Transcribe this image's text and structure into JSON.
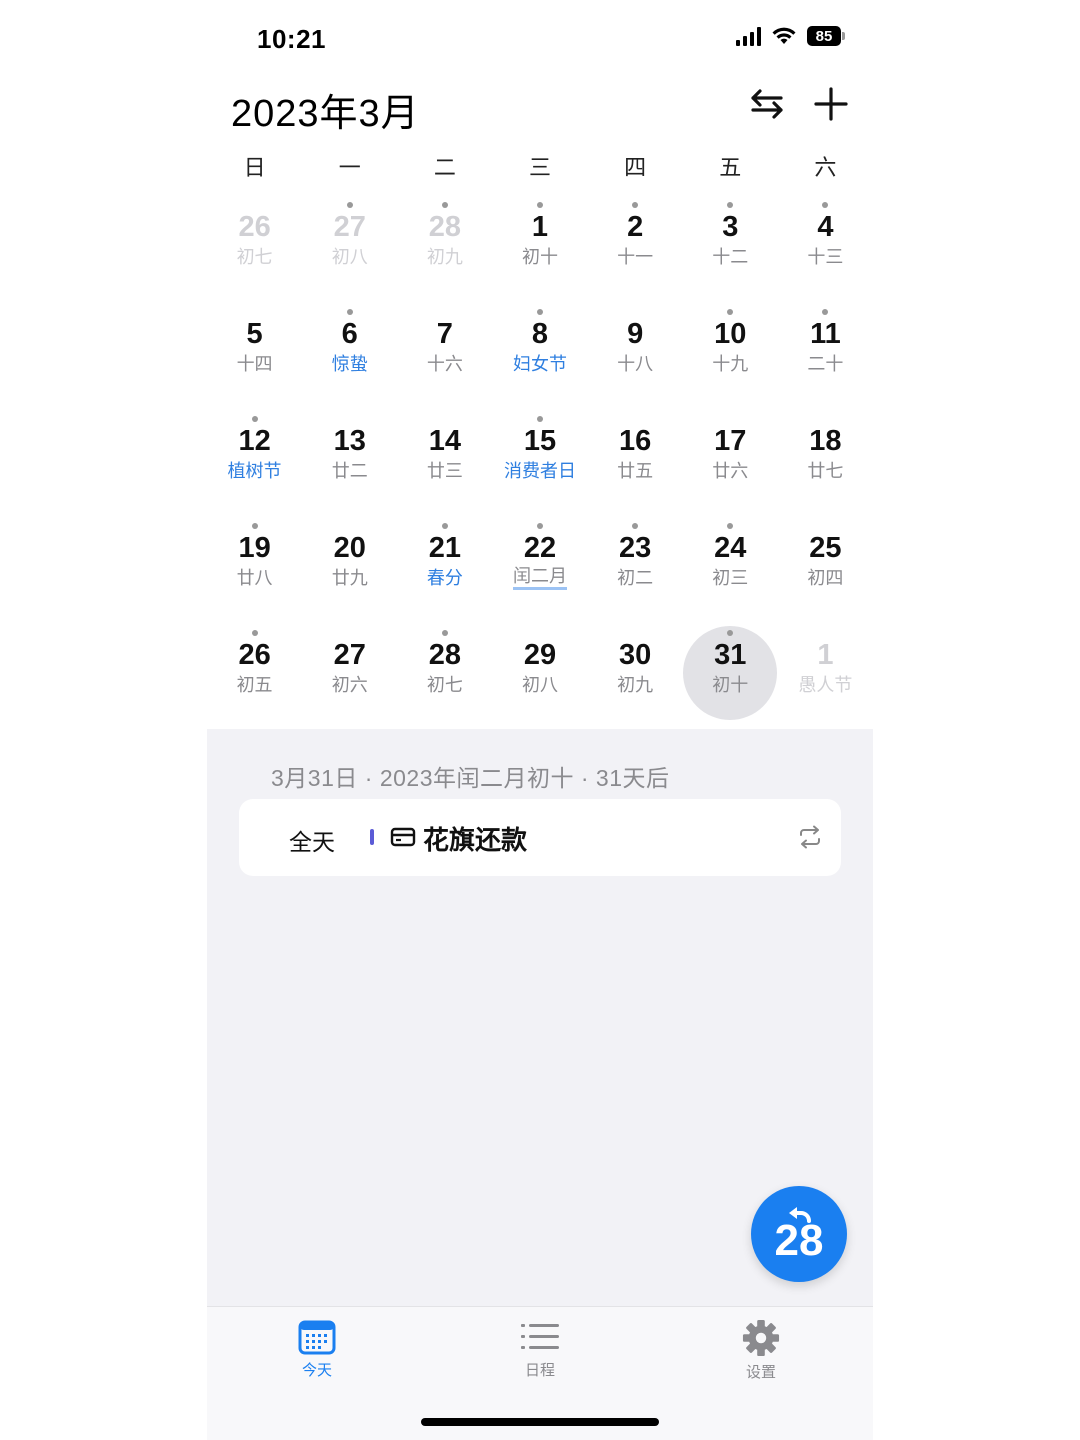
{
  "status": {
    "time": "10:21",
    "battery": "85"
  },
  "header": {
    "title": "2023年3月"
  },
  "weekdays": [
    "日",
    "一",
    "二",
    "三",
    "四",
    "五",
    "六"
  ],
  "days": [
    {
      "n": "26",
      "s": "初七",
      "other": true,
      "dot": false
    },
    {
      "n": "27",
      "s": "初八",
      "other": true,
      "dot": true
    },
    {
      "n": "28",
      "s": "初九",
      "other": true,
      "dot": true
    },
    {
      "n": "1",
      "s": "初十",
      "dot": true
    },
    {
      "n": "2",
      "s": "十一",
      "dot": true
    },
    {
      "n": "3",
      "s": "十二",
      "dot": true
    },
    {
      "n": "4",
      "s": "十三",
      "dot": true
    },
    {
      "n": "5",
      "s": "十四",
      "dot": false
    },
    {
      "n": "6",
      "s": "惊蛰",
      "holiday": true,
      "dot": true
    },
    {
      "n": "7",
      "s": "十六",
      "dot": false
    },
    {
      "n": "8",
      "s": "妇女节",
      "holiday": true,
      "dot": true
    },
    {
      "n": "9",
      "s": "十八",
      "dot": false
    },
    {
      "n": "10",
      "s": "十九",
      "dot": true
    },
    {
      "n": "11",
      "s": "二十",
      "dot": true
    },
    {
      "n": "12",
      "s": "植树节",
      "holiday": true,
      "dot": true
    },
    {
      "n": "13",
      "s": "廿二",
      "dot": false
    },
    {
      "n": "14",
      "s": "廿三",
      "dot": false
    },
    {
      "n": "15",
      "s": "消费者日",
      "holiday": true,
      "dot": true
    },
    {
      "n": "16",
      "s": "廿五",
      "dot": false
    },
    {
      "n": "17",
      "s": "廿六",
      "dot": false
    },
    {
      "n": "18",
      "s": "廿七",
      "dot": false
    },
    {
      "n": "19",
      "s": "廿八",
      "dot": true
    },
    {
      "n": "20",
      "s": "廿九",
      "dot": false
    },
    {
      "n": "21",
      "s": "春分",
      "holiday": true,
      "dot": true
    },
    {
      "n": "22",
      "s": "闰二月",
      "special": true,
      "dot": true
    },
    {
      "n": "23",
      "s": "初二",
      "dot": true
    },
    {
      "n": "24",
      "s": "初三",
      "dot": true
    },
    {
      "n": "25",
      "s": "初四",
      "dot": false
    },
    {
      "n": "26",
      "s": "初五",
      "dot": true
    },
    {
      "n": "27",
      "s": "初六",
      "dot": false
    },
    {
      "n": "28",
      "s": "初七",
      "dot": true
    },
    {
      "n": "29",
      "s": "初八",
      "dot": false
    },
    {
      "n": "30",
      "s": "初九",
      "dot": false
    },
    {
      "n": "31",
      "s": "初十",
      "selected": true,
      "dot": true
    },
    {
      "n": "1",
      "s": "愚人节",
      "other": true,
      "dot": false
    }
  ],
  "agenda": {
    "date_line": "3月31日 · 2023年闰二月初十 · 31天后",
    "event": {
      "allday": "全天",
      "title": "花旗还款",
      "icon": "card-icon",
      "repeat_icon": "repeat-icon",
      "bar_color": "#5b5bd6"
    }
  },
  "fab": {
    "label": "28",
    "icon": "back-arrow-icon"
  },
  "tabs": [
    {
      "label": "今天",
      "icon": "calendar-icon",
      "active": true
    },
    {
      "label": "日程",
      "icon": "list-icon",
      "active": false
    },
    {
      "label": "设置",
      "icon": "gear-icon",
      "active": false
    }
  ],
  "colors": {
    "accent": "#1a7ff0",
    "holiday": "#2f7fe0",
    "agenda_bg": "#f2f2f6"
  }
}
